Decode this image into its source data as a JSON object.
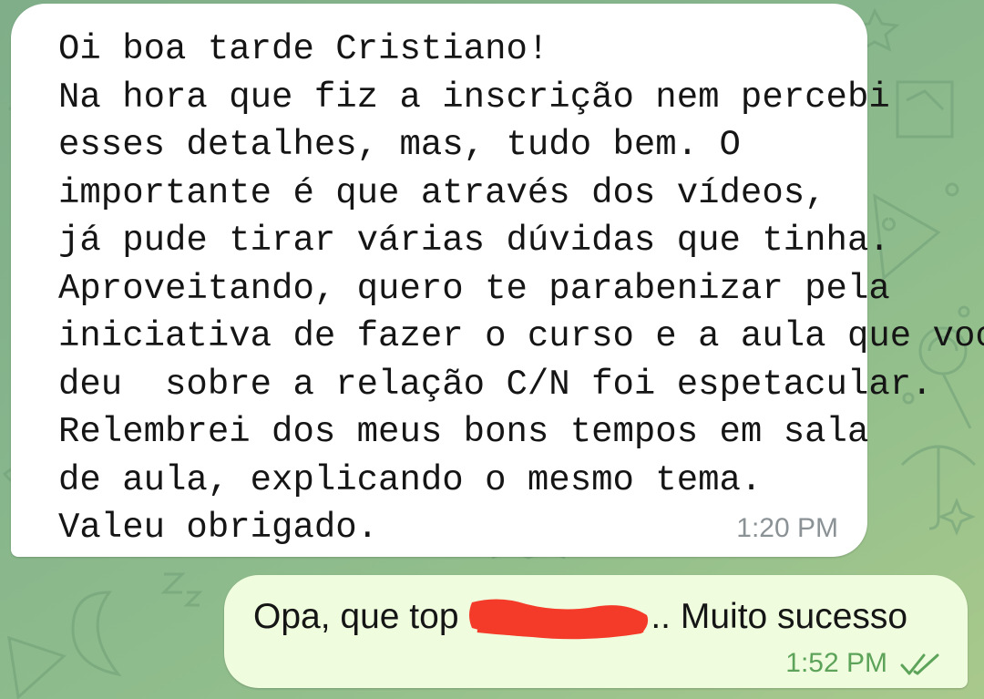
{
  "messages": {
    "incoming": {
      "lines": [
        "Oi boa tarde Cristiano!",
        "Na hora que fiz a inscrição nem percebi",
        "esses detalhes, mas, tudo bem. O",
        "importante é que através dos vídeos,",
        "já pude tirar várias dúvidas que tinha.",
        "Aproveitando, quero te parabenizar pela",
        "iniciativa de fazer o curso e a aula que você",
        "deu  sobre a relação C/N foi espetacular.",
        "Relembrei dos meus bons tempos em sala",
        "de aula, explicando o mesmo tema.",
        "Valeu obrigado."
      ],
      "time": "1:20 PM"
    },
    "outgoing": {
      "text_before": "Opa, que top ",
      "text_after": ".. Muito sucesso",
      "time": "1:52 PM",
      "status_icon": "double-check-icon"
    }
  },
  "colors": {
    "wallpaper": "#86b58c",
    "incoming_bubble": "#ffffff",
    "outgoing_bubble": "#effdde",
    "outgoing_time": "#5da35a",
    "incoming_time": "#8b9295",
    "redaction_marker": "#f43a28"
  }
}
